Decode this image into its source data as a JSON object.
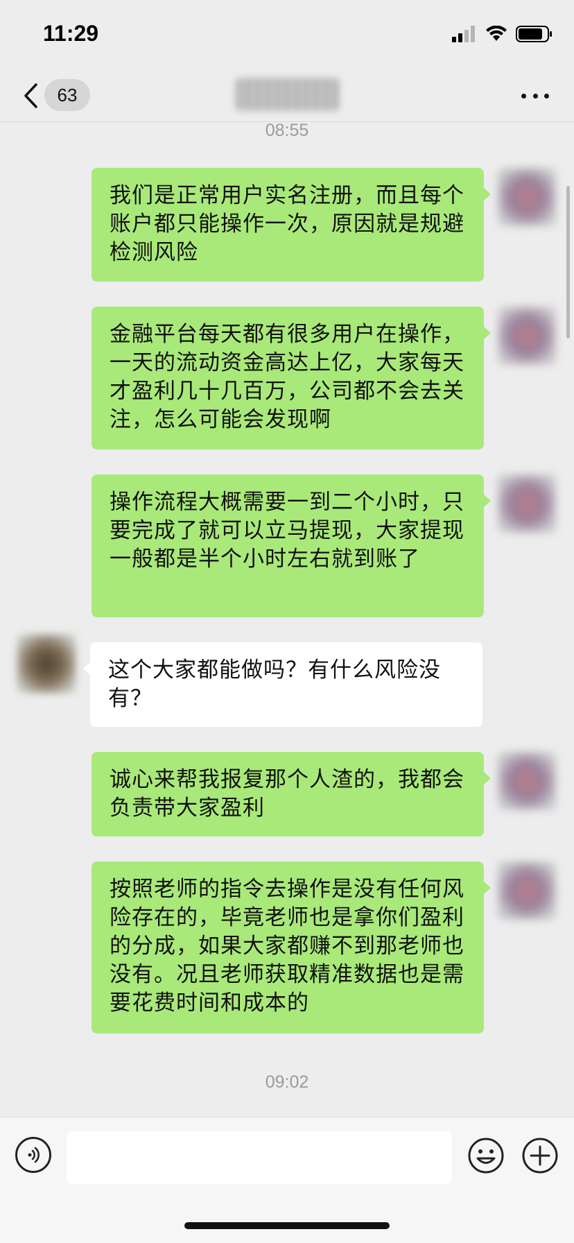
{
  "status_bar": {
    "time": "11:29"
  },
  "nav": {
    "unread_count": "63",
    "back_icon": "chevron-left-icon",
    "more_icon": "more-horizontal-icon"
  },
  "chat": {
    "timestamps": [
      "08:55",
      "09:02"
    ],
    "messages": [
      {
        "side": "out",
        "text": "我们是正常用户实名注册，而且每个账户都只能操作一次，原因就是规避检测风险"
      },
      {
        "side": "out",
        "text": "金融平台每天都有很多用户在操作，一天的流动资金高达上亿，大家每天才盈利几十几百万，公司都不会去关注，怎么可能会发现啊"
      },
      {
        "side": "out",
        "text": "操作流程大概需要一到二个小时，只要完成了就可以立马提现，大家提现一般都是半个小时左右就到账了"
      },
      {
        "side": "in",
        "text": "这个大家都能做吗？有什么风险没有？"
      },
      {
        "side": "out",
        "text": "诚心来帮我报复那个人渣的，我都会负责带大家盈利"
      },
      {
        "side": "out",
        "text": "按照老师的指令去操作是没有任何风险存在的，毕竟老师也是拿你们盈利的分成，如果大家都赚不到那老师也没有。况且老师获取精准数据也是需要花费时间和成本的"
      }
    ]
  },
  "input_bar": {
    "value": "",
    "voice_icon": "voice-icon",
    "emoji_icon": "emoji-icon",
    "plus_icon": "plus-icon"
  },
  "colors": {
    "background": "#ededed",
    "outgoing_bubble": "#a9e97a",
    "incoming_bubble": "#ffffff",
    "timestamp": "#9b9b9b"
  }
}
